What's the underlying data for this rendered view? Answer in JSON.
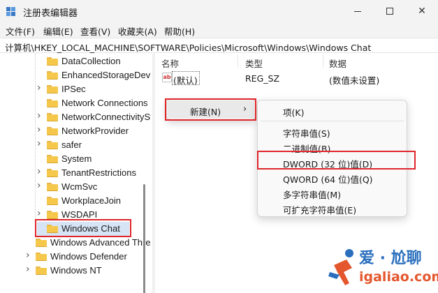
{
  "window": {
    "title": "注册表编辑器",
    "controls": {
      "minimize": "",
      "maximize": "",
      "close": "✕"
    }
  },
  "menubar": {
    "items": [
      "文件(F)",
      "编辑(E)",
      "查看(V)",
      "收藏夹(A)",
      "帮助(H)"
    ]
  },
  "address": {
    "path": "计算机\\HKEY_LOCAL_MACHINE\\SOFTWARE\\Policies\\Microsoft\\Windows\\Windows Chat"
  },
  "tree": {
    "items": [
      {
        "label": "DataCollection",
        "expandable": false
      },
      {
        "label": "EnhancedStorageDevices",
        "expandable": false
      },
      {
        "label": "IPSec",
        "expandable": true
      },
      {
        "label": "Network Connections",
        "expandable": false
      },
      {
        "label": "NetworkConnectivityStatusIndicator",
        "expandable": true
      },
      {
        "label": "NetworkProvider",
        "expandable": true
      },
      {
        "label": "safer",
        "expandable": true
      },
      {
        "label": "System",
        "expandable": false
      },
      {
        "label": "TenantRestrictions",
        "expandable": true
      },
      {
        "label": "WcmSvc",
        "expandable": true
      },
      {
        "label": "WorkplaceJoin",
        "expandable": false
      },
      {
        "label": "WSDAPI",
        "expandable": true
      },
      {
        "label": "Windows Chat",
        "expandable": false,
        "selected": true
      },
      {
        "label": "Windows Advanced Threat Protection",
        "expandable": false
      },
      {
        "label": "Windows Defender",
        "expandable": true
      },
      {
        "label": "Windows NT",
        "expandable": true
      }
    ]
  },
  "list": {
    "columns": [
      "名称",
      "类型",
      "数据"
    ],
    "rows": [
      {
        "icon": "ab",
        "name": "(默认)",
        "type": "REG_SZ",
        "data": "(数值未设置)"
      }
    ]
  },
  "context_menu": {
    "parent_label": "新建(N)",
    "parent_arrow": "›",
    "submenu": {
      "key_item": "项(K)",
      "items": [
        "字符串值(S)",
        "二进制值(B)",
        "DWORD (32 位)值(D)",
        "QWORD (64 位)值(Q)",
        "多字符串值(M)",
        "可扩充字符串值(E)"
      ]
    }
  },
  "watermark": {
    "title": "爱 · 尬聊",
    "url": "igaliao.com"
  },
  "colors": {
    "highlight_red": "#e0262b",
    "folder_yellow": "#f5c84c",
    "selection": "#d6e4f5"
  }
}
